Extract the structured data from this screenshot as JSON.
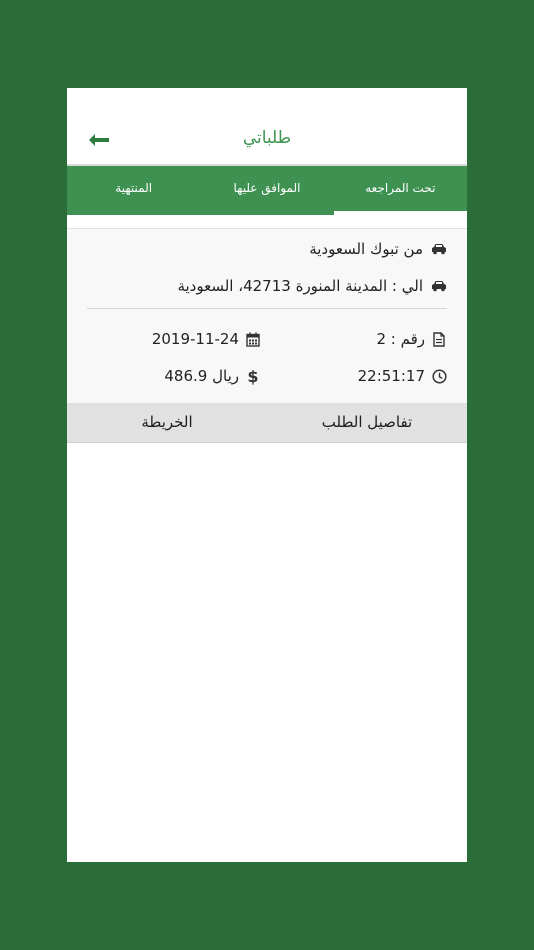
{
  "header": {
    "title": "طلباتي",
    "back_icon": "arrow-left-icon"
  },
  "tabs": [
    {
      "label": "تحت المراجعه",
      "active": true
    },
    {
      "label": "الموافق عليها",
      "active": false
    },
    {
      "label": "المنتهية",
      "active": false
    }
  ],
  "order": {
    "from": "من تبوك السعودية",
    "to": "الي : المدينة المنورة 42713، السعودية",
    "number": "رقم : 2",
    "date": "2019-11-24",
    "time": "22:51:17",
    "price": "486.9 ريال"
  },
  "actions": {
    "details": "تفاصيل الطلب",
    "map": "الخريطة"
  },
  "colors": {
    "background": "#2a6d38",
    "tab_bar": "#3e9150",
    "title": "#3c9550"
  }
}
